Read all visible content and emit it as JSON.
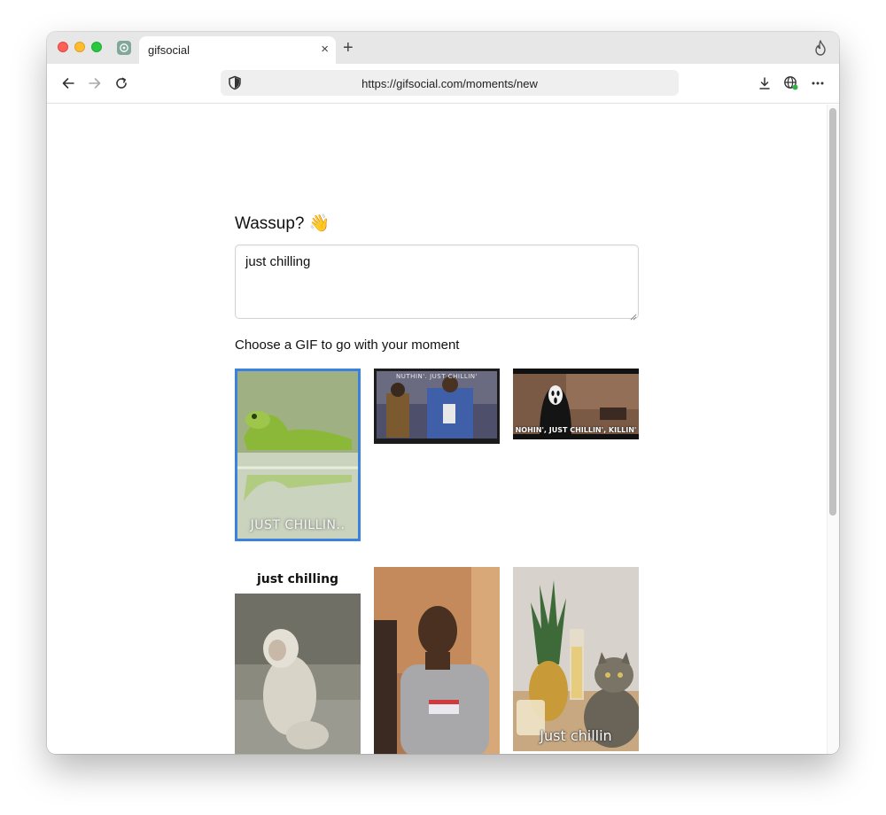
{
  "browser": {
    "tab_title": "gifsocial",
    "tab_close": "×",
    "new_tab": "+",
    "url": "https://gifsocial.com/moments/new"
  },
  "page": {
    "heading": "Wassup? 👋",
    "moment_text": "just chilling",
    "gif_prompt": "Choose a GIF to go with your moment"
  },
  "gifs": [
    {
      "caption": "JUST CHILLIN..",
      "selected": true
    },
    {
      "caption": "NUTHIN'. JUST CHILLIN'",
      "selected": false
    },
    {
      "caption": "NOHIN', JUST CHILLIN', KILLIN'",
      "selected": false
    },
    {
      "caption": "just chilling",
      "selected": false
    },
    {
      "caption": "",
      "selected": false
    },
    {
      "caption": "Just chillin",
      "selected": false
    }
  ],
  "colors": {
    "selection_border": "#3b82e0",
    "tab_bar": "#e7e7e7",
    "url_bar": "#efefef"
  }
}
